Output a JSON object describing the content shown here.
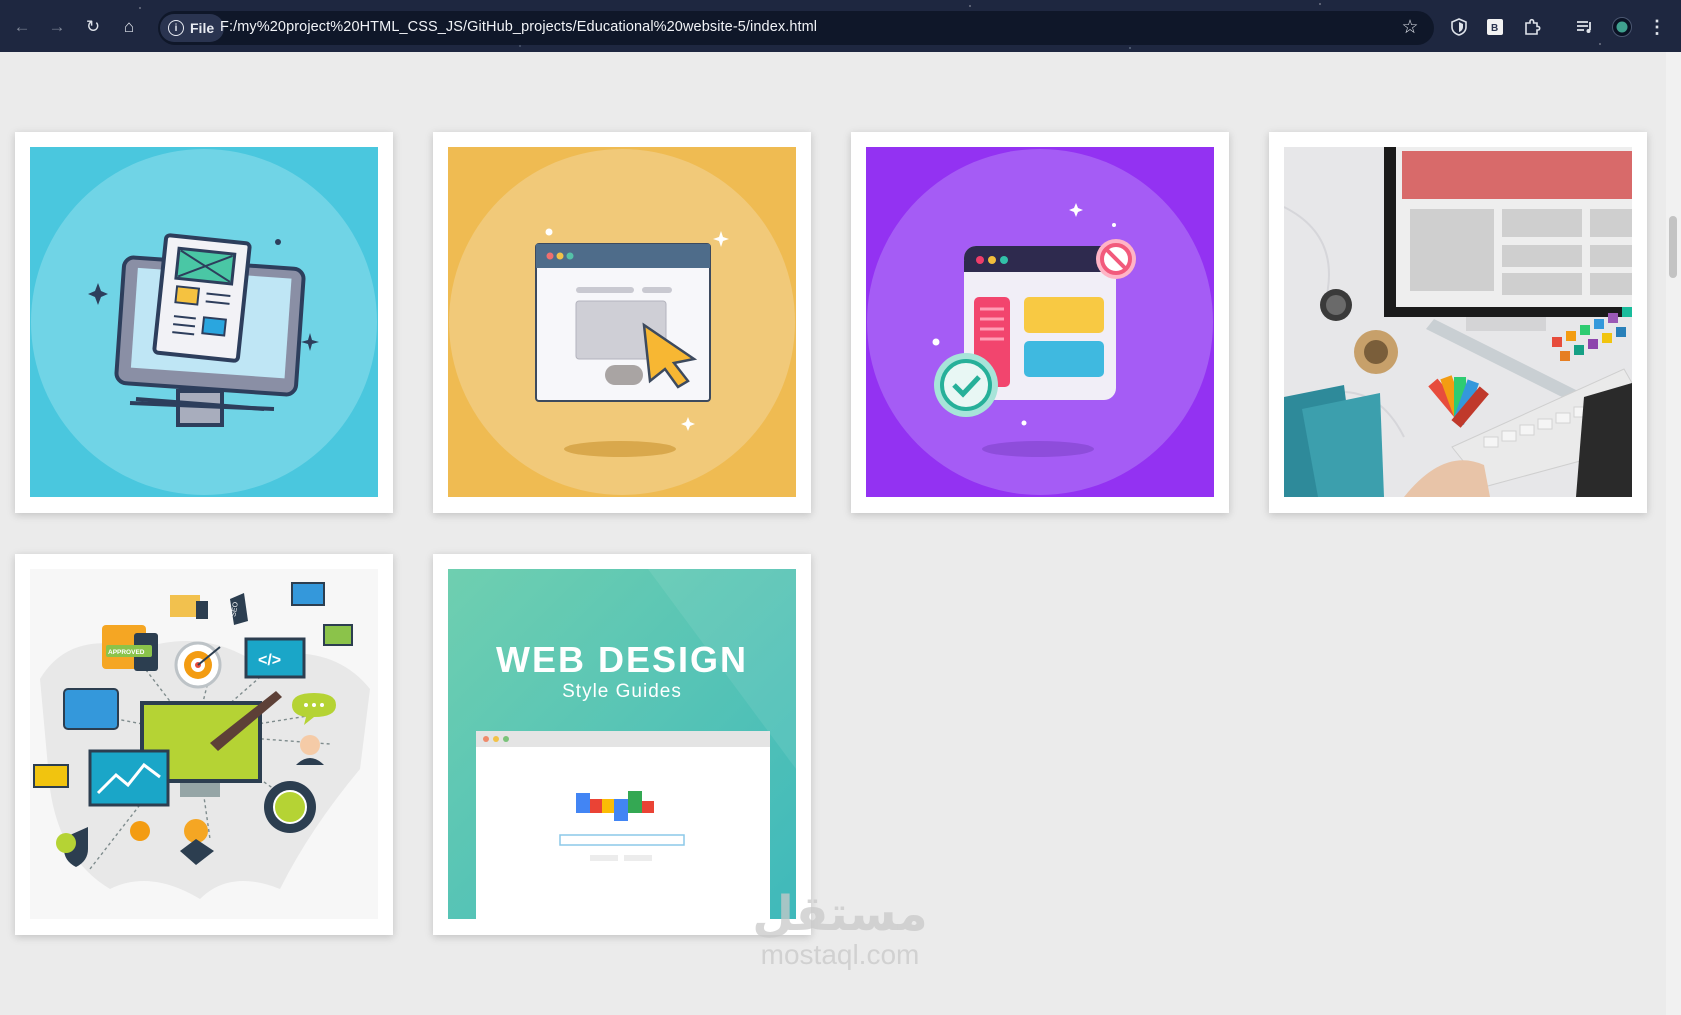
{
  "browser": {
    "url": "F:/my%20project%20HTML_CSS_JS/GitHub_projects/Educational%20website-5/index.html",
    "site_chip": "File",
    "icons": [
      "back-arrow-icon",
      "forward-arrow-icon",
      "reload-icon",
      "home-icon",
      "info-icon",
      "star-icon",
      "shield-icon",
      "b-extension-icon",
      "puzzle-icon",
      "playlist-icon",
      "profile-icon",
      "kebab-menu-icon"
    ]
  },
  "gallery": {
    "cards": [
      {
        "subject": "monitor with webpage wireframe, cyan background"
      },
      {
        "subject": "browser window with cursor, yellow background"
      },
      {
        "subject": "browser window with check and block badges, purple background"
      },
      {
        "subject": "designer desk photo with monitor and color swatches"
      },
      {
        "subject": "digital marketing icons network"
      },
      {
        "subject": "web design style guides poster"
      }
    ],
    "poster_title": "WEB DESIGN",
    "poster_subtitle": "Style Guides",
    "approved_badge": "APPROVED",
    "seo_tag": "SEO",
    "code_symbol": "</>"
  },
  "watermark": {
    "arabic": "مستقل",
    "latin": "mostaql.com"
  }
}
